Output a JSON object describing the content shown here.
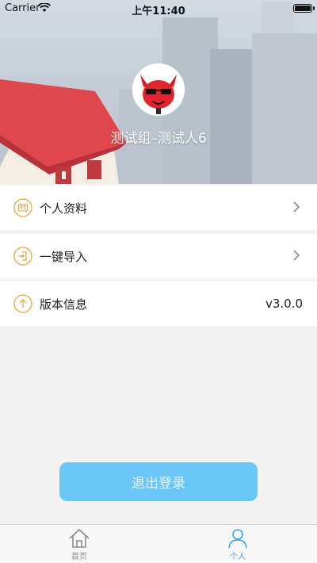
{
  "status_bar": {
    "carrier": "Carrier",
    "time": "上午11:40"
  },
  "profile": {
    "name": "测试组–测试人6"
  },
  "menu": {
    "items": [
      {
        "label": "个人资料",
        "icon": "profile-card-icon"
      },
      {
        "label": "一键导入",
        "icon": "import-icon"
      },
      {
        "label": "版本信息",
        "icon": "upgrade-arrow-icon",
        "value": "v3.0.0"
      }
    ]
  },
  "logout_label": "退出登录",
  "tabbar": {
    "tabs": [
      {
        "label": "首页",
        "icon": "home-icon",
        "active": false
      },
      {
        "label": "个人",
        "icon": "person-icon",
        "active": true
      }
    ]
  },
  "colors": {
    "accent": "#3aa0f0",
    "logout_bg": "#6ac6f9",
    "menu_icon": "#f0a43a"
  }
}
